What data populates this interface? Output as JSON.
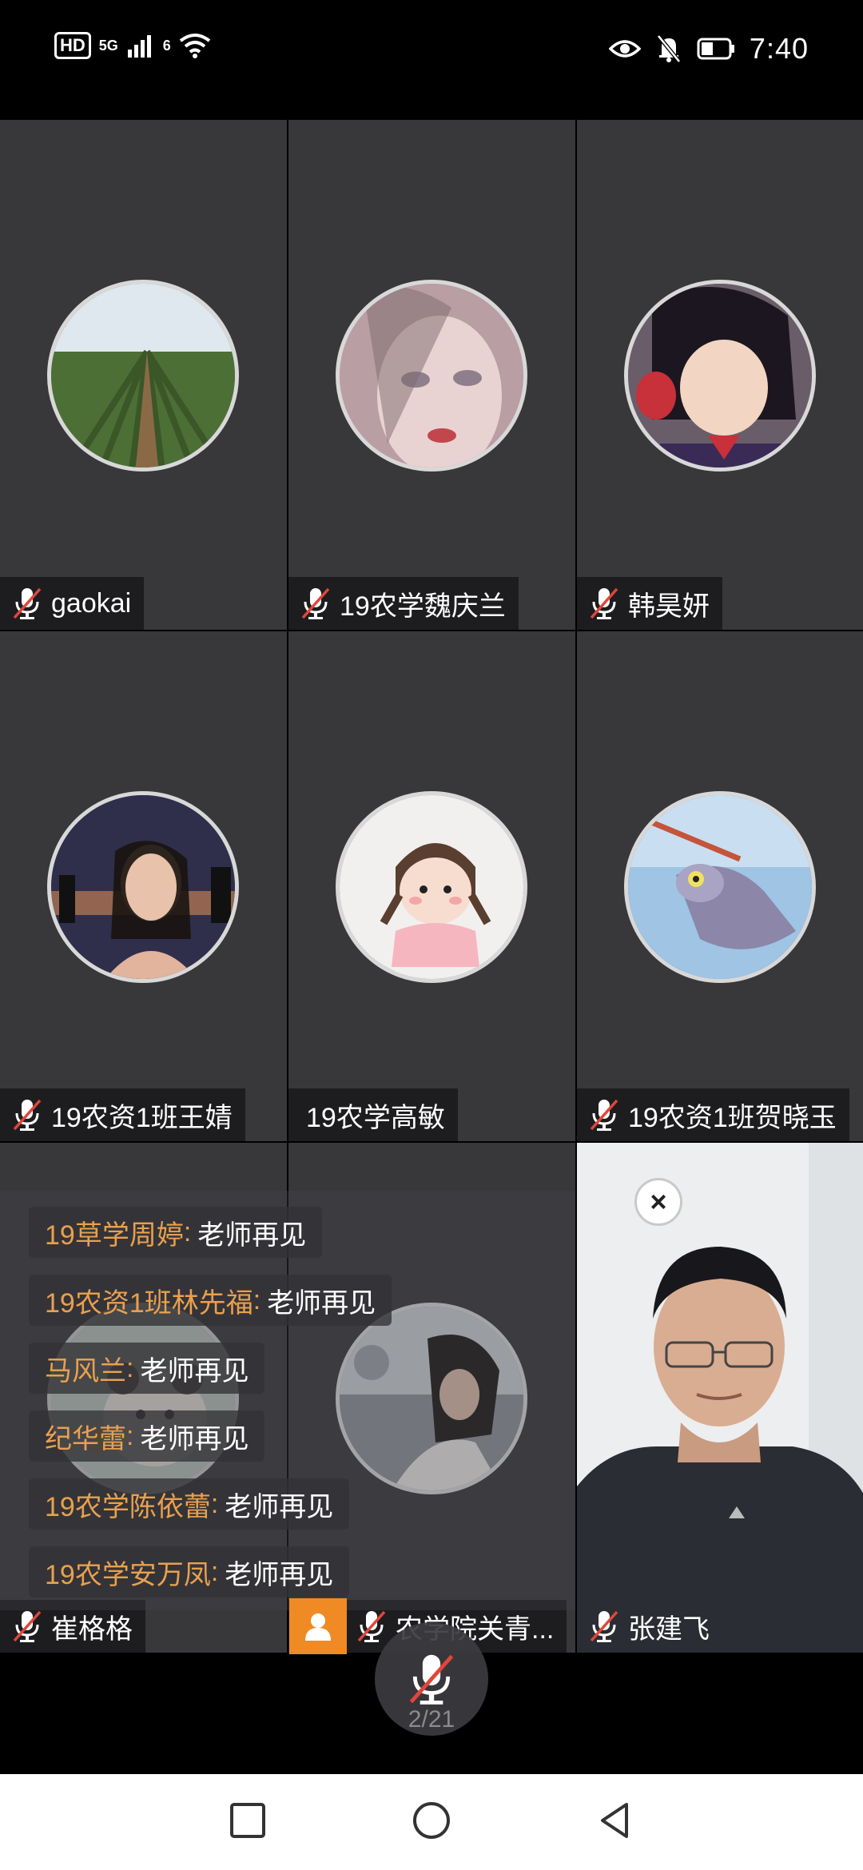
{
  "status_bar": {
    "hd": "HD",
    "signal": "5G",
    "wifi": "6",
    "time": "7:40",
    "icons": [
      "eye-icon",
      "bell-off-icon",
      "battery-icon"
    ]
  },
  "tiles": [
    {
      "name": "gaokai",
      "muted": true,
      "avatar": "farmland-field"
    },
    {
      "name": "19农学魏庆兰",
      "muted": true,
      "avatar": "anime-girl-face"
    },
    {
      "name": "韩昊妍",
      "muted": true,
      "avatar": "anime-sailor-girl"
    },
    {
      "name": "19农资1班王婧",
      "muted": true,
      "avatar": "woman-night-city"
    },
    {
      "name": "19农学高敏",
      "muted": false,
      "avatar": "cartoon-girl-pigtails"
    },
    {
      "name": "19农资1班贺晓玉",
      "muted": true,
      "avatar": "cartoon-cat-tom"
    },
    {
      "name": "崔格格",
      "muted": true,
      "avatar": "bear-cartoon"
    },
    {
      "name": "农学院关青...",
      "muted": true,
      "avatar": "girl-in-car"
    },
    {
      "name": "张建飞",
      "muted": true,
      "avatar": "presenter-video"
    }
  ],
  "chat": [
    {
      "user": "19草学周婷",
      "text": "老师再见"
    },
    {
      "user": "19农资1班林先福",
      "text": "老师再见"
    },
    {
      "user": "马风兰",
      "text": "老师再见"
    },
    {
      "user": "纪华蕾",
      "text": "老师再见"
    },
    {
      "user": "19农学陈依蕾",
      "text": "老师再见"
    },
    {
      "user": "19农学安万凤",
      "text": "老师再见"
    }
  ],
  "presenter": {
    "close_label": "×"
  },
  "center_mic": {
    "page": "2/21"
  },
  "colors": {
    "tile_bg": "#38383b",
    "accent": "#f08a24",
    "chat_user": "#e9a04f"
  }
}
